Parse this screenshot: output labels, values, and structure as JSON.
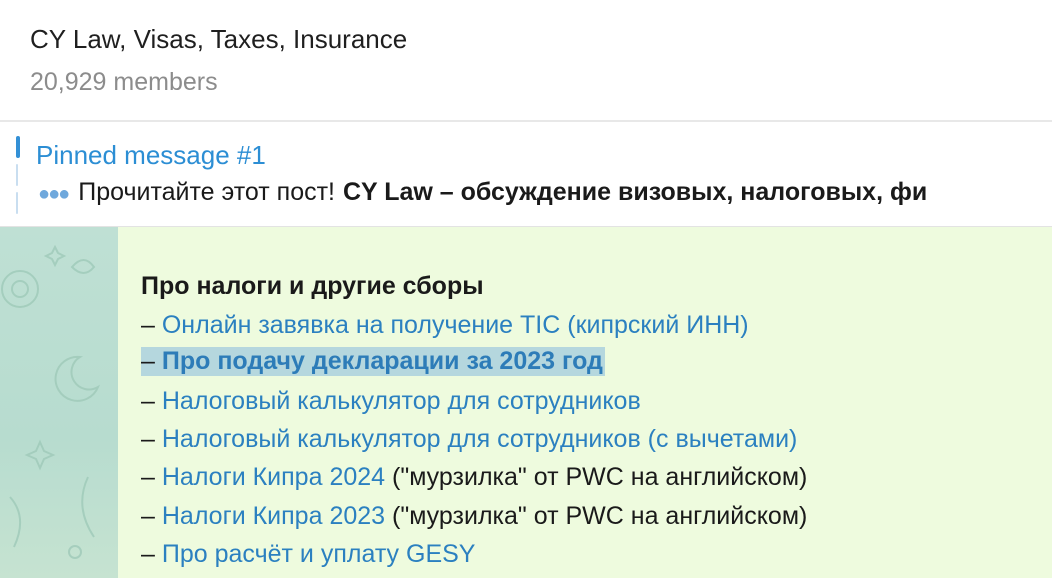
{
  "header": {
    "title": "CY Law, Visas, Taxes, Insurance",
    "members": "20,929 members"
  },
  "pinned": {
    "label": "Pinned message #1",
    "preview_text": "Прочитайте этот пост!",
    "preview_bold": "CY Law – обсуждение визовых, налоговых, фи"
  },
  "message": {
    "section_title": "Про налоги и другие сборы",
    "items": [
      {
        "dash": "– ",
        "link": "Онлайн завявка на получение TIC (кипрский ИНН)",
        "suffix": ""
      },
      {
        "dash": "– ",
        "link": "Про подачу декларации за 2023 год",
        "suffix": ""
      },
      {
        "dash": "– ",
        "link": "Налоговый калькулятор для сотрудников",
        "suffix": ""
      },
      {
        "dash": "– ",
        "link": "Налоговый калькулятор для сотрудников (с вычетами)",
        "suffix": ""
      },
      {
        "dash": "– ",
        "link": "Налоги Кипра 2024",
        "suffix": " (\"мурзилка\" от PWC на английском)"
      },
      {
        "dash": "– ",
        "link": "Налоги Кипра 2023",
        "suffix": " (\"мурзилка\" от PWC на английском)"
      },
      {
        "dash": "– ",
        "link": "Про расчёт и уплату GESY",
        "suffix": ""
      }
    ]
  },
  "colors": {
    "link": "#2b80c0",
    "pinned_accent": "#2c8ed4",
    "bubble_bg": "#eefbde",
    "highlight": "#b5d7de"
  }
}
